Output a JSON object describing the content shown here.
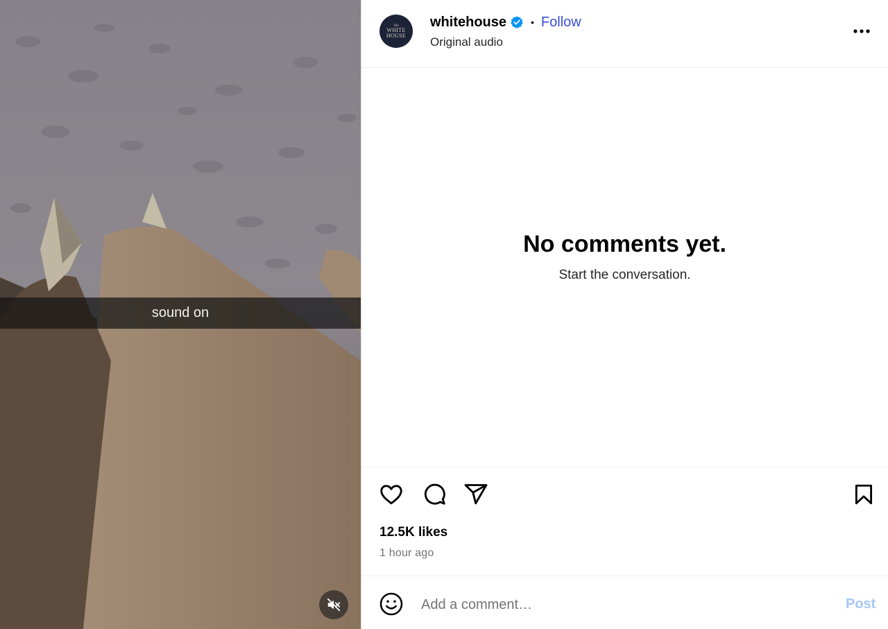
{
  "media": {
    "overlay_text": "sound on",
    "mute_icon": "speaker-muted-icon"
  },
  "header": {
    "username": "whitehouse",
    "verified_icon": "verified-badge-icon",
    "separator": "•",
    "follow_label": "Follow",
    "audio_label": "Original audio",
    "avatar_text": {
      "line1": "The",
      "line2": "WHITE",
      "line3": "HOUSE"
    },
    "more_icon": "more-options-icon"
  },
  "comments": {
    "empty_title": "No comments yet.",
    "empty_subtitle": "Start the conversation."
  },
  "actions": {
    "like_icon": "heart-icon",
    "comment_icon": "comment-icon",
    "share_icon": "share-icon",
    "save_icon": "bookmark-icon",
    "likes": "12.5K likes",
    "timestamp": "1 hour ago"
  },
  "comment_bar": {
    "emoji_icon": "emoji-icon",
    "placeholder": "Add a comment…",
    "post_label": "Post"
  },
  "colors": {
    "link": "#3b4ed6",
    "verified": "#0095f6",
    "post_disabled": "#a6c6f5",
    "secondary_text": "#737373"
  }
}
